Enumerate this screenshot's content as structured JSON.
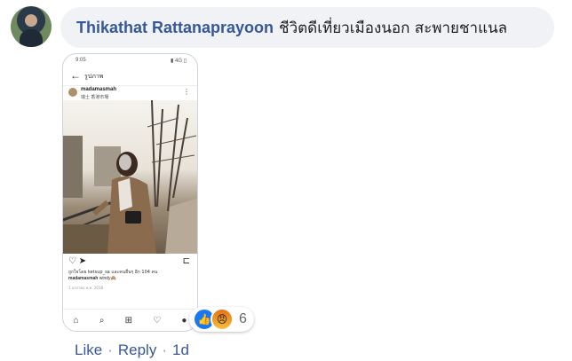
{
  "comment": {
    "author": "Thikathat Rattanaprayoon",
    "text": "ชีวิตดีเที่ยวเมืองนอก สะพายชาแนล"
  },
  "screenshot": {
    "status_time": "9:05",
    "status_right": "▮ 4G ▯",
    "page_title": "รูปภาพ",
    "post_user": "madamasmah",
    "post_location": "瑞士 香港市場",
    "likes_text": "ถูกใจโดย ketsup_sa และคนอื่นๆ อีก 104 คน",
    "caption_user": "madamasmah",
    "caption_text": "windy🙈",
    "post_date": "1 มกราคม ค.ศ. 2018"
  },
  "reactions": {
    "count": "6",
    "types": [
      "like-icon",
      "angry-icon"
    ],
    "colors": {
      "like": "#1877f2",
      "angry": "#f7b125"
    }
  },
  "footer": {
    "like_label": "Like",
    "reply_label": "Reply",
    "separator": "·",
    "time": "1d"
  }
}
